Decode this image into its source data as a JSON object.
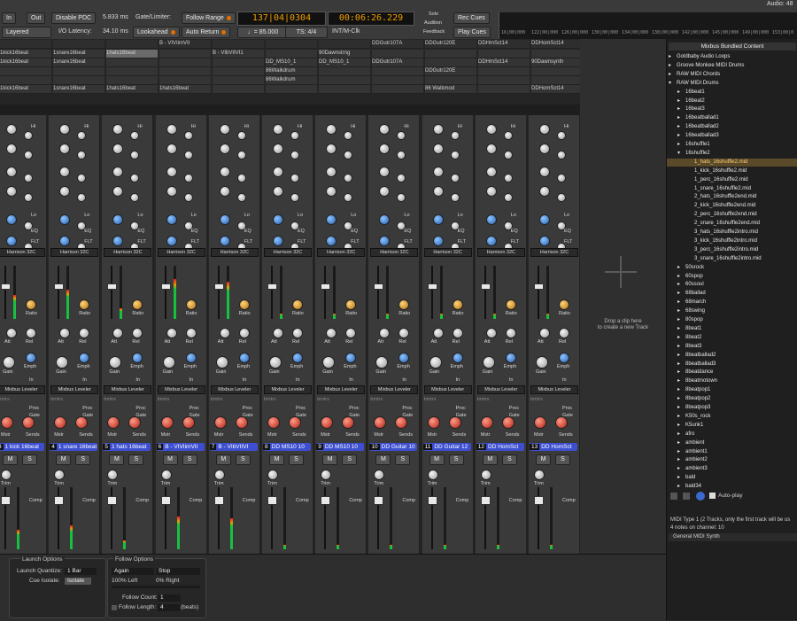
{
  "toolbar": {
    "in_label": "In",
    "out_label": "Out",
    "layered_label": "Layered",
    "disable_pdc_label": "Disable PDC",
    "pdc_value": "5.833 ms",
    "io_latency_label": "I/O Latency:",
    "io_latency_value": "34.10 ms",
    "gate_limiter_label": "Gate/Limiter:",
    "lookahead_label": "Lookahead",
    "follow_range_label": "Follow Range",
    "auto_return_label": "Auto Return",
    "bbt_clock": "137|04|0304",
    "time_clock": "00:06:26.229",
    "tempo": "♩= 85.000",
    "time_sig": "TS: 4/4",
    "sync_label": "INT/M-Clk",
    "solo_label": "Solo",
    "audition_label": "Audition",
    "feedback_label": "Feedback",
    "rec_cues_label": "Rec Cues",
    "play_cues_label": "Play Cues",
    "audio_status": "Audio: 48",
    "ruler_ticks": [
      "16|00|000",
      "122|00|000",
      "126|00|000",
      "130|00|000",
      "134|00|000",
      "138|00|000",
      "142|00|000",
      "145|00|000",
      "149|00|000",
      "153|00|0"
    ]
  },
  "cues": {
    "columns": [
      {
        "header": "",
        "cells": [
          "1kick16beat",
          "1kick16beat",
          "",
          "",
          "1kick16beat"
        ]
      },
      {
        "header": "",
        "cells": [
          "1snare16beat",
          "1snare16beat",
          "",
          "",
          "1snare16beat"
        ]
      },
      {
        "header": "",
        "cells": [
          "1hats16beat",
          "",
          "",
          "",
          "1hats16beat"
        ]
      },
      {
        "header": "B - VIVIimVII",
        "cells": [
          "",
          "",
          "",
          "",
          "1hats16beat"
        ]
      },
      {
        "header": "",
        "cells": [
          "B - VIbVIIVI1",
          "",
          "",
          "",
          ""
        ]
      },
      {
        "header": "",
        "cells": [
          "",
          "DD_MS10_1",
          "86Walkdrum",
          "86Walkdrum",
          ""
        ]
      },
      {
        "header": "",
        "cells": [
          "90Dawnstrng",
          "DD_MS10_1",
          "",
          "",
          ""
        ]
      },
      {
        "header": "DDGutr107A",
        "cells": [
          "",
          "DDGutr107A",
          "",
          "",
          ""
        ]
      },
      {
        "header": "DDGutr120E",
        "cells": [
          "",
          "",
          "DDGutr120E",
          "",
          "86 Walkmod"
        ]
      },
      {
        "header": "DDHmSct14",
        "cells": [
          "",
          "DDHmSct14",
          "",
          "",
          ""
        ]
      },
      {
        "header": "DDHomSct14",
        "cells": [
          "",
          "90Dawnsynth",
          "",
          "",
          "DDHomSct14"
        ]
      }
    ]
  },
  "strips": [
    {
      "num": "3",
      "name": "1 kick 16beat",
      "eq_plugin": "Harrison 32C",
      "dyn_plugin": "Mixbus Leveler",
      "meter": 0.45
    },
    {
      "num": "4",
      "name": "1 snare 16beat",
      "eq_plugin": "Harrison 32C",
      "dyn_plugin": "Mixbus Leveler",
      "meter": 0.55
    },
    {
      "num": "5",
      "name": "1 hats 16beat",
      "eq_plugin": "Harrison 32C",
      "dyn_plugin": "Mixbus Leveler",
      "meter": 0.2
    },
    {
      "num": "6",
      "name": "B - VIVIimVII",
      "eq_plugin": "Harrison 32C",
      "dyn_plugin": "Mixbus Leveler",
      "meter": 0.75
    },
    {
      "num": "7",
      "name": "B - VIbVIIVI",
      "eq_plugin": "Harrison 32C",
      "dyn_plugin": "Mixbus Leveler",
      "meter": 0.7
    },
    {
      "num": "8",
      "name": "DD MS10 10",
      "eq_plugin": "Harrison 32C",
      "dyn_plugin": "Mixbus Leveler",
      "meter": 0.1
    },
    {
      "num": "9",
      "name": "DD MS10 10",
      "eq_plugin": "Harrison 32C",
      "dyn_plugin": "Mixbus Leveler",
      "meter": 0.1
    },
    {
      "num": "10",
      "name": "DD Guitar 10",
      "eq_plugin": "Harrison 32C",
      "dyn_plugin": "Mixbus Leveler",
      "meter": 0.1
    },
    {
      "num": "11",
      "name": "DD Guitar 12",
      "eq_plugin": "Harrison 32C",
      "dyn_plugin": "Mixbus Leveler",
      "meter": 0.1
    },
    {
      "num": "12",
      "name": "DD HomSct",
      "eq_plugin": "Harrison 32C",
      "dyn_plugin": "Mixbus Leveler",
      "meter": 0.1
    },
    {
      "num": "13",
      "name": "DD HomSct",
      "eq_plugin": "Harrison 32C",
      "dyn_plugin": "Mixbus Leveler",
      "meter": 0.1
    }
  ],
  "strip_labels": {
    "hi": "Hi",
    "lo": "Lo",
    "eq": "EQ",
    "flt": "FLT",
    "ratio": "Ratio",
    "att": "Att",
    "rel": "Rel",
    "emph": "Emph",
    "gain": "Gain",
    "in": "In",
    "sends": "Sends",
    "mstr": "Mstr",
    "trim": "Trim",
    "m": "M",
    "s": "S",
    "comp": "Comp",
    "gate": "Gate",
    "proc": "Proc",
    "bmtrs": "bmtrs"
  },
  "drop": {
    "line1": "Drop a clip here",
    "line2": "to create a new Track"
  },
  "sidebar": {
    "title": "Mixbus Bundled Content",
    "items": [
      {
        "label": "Goldbaby Audio Loops",
        "depth": 0,
        "arrow": "▸"
      },
      {
        "label": "Groove Monkee MIDI Drums",
        "depth": 0,
        "arrow": "▸"
      },
      {
        "label": "RAW MIDI Chords",
        "depth": 0,
        "arrow": "▸"
      },
      {
        "label": "RAW MIDI Drums",
        "depth": 0,
        "arrow": "▾"
      },
      {
        "label": "16beat1",
        "depth": 1,
        "arrow": "▸"
      },
      {
        "label": "16beat2",
        "depth": 1,
        "arrow": "▸"
      },
      {
        "label": "16beat3",
        "depth": 1,
        "arrow": "▸"
      },
      {
        "label": "16beatballad1",
        "depth": 1,
        "arrow": "▸"
      },
      {
        "label": "16beatballad2",
        "depth": 1,
        "arrow": "▸"
      },
      {
        "label": "16beatballad3",
        "depth": 1,
        "arrow": "▸"
      },
      {
        "label": "16shuffle1",
        "depth": 1,
        "arrow": "▸"
      },
      {
        "label": "16shuffle2",
        "depth": 1,
        "arrow": "▾"
      },
      {
        "label": "1_hats_16shuffle2.mid",
        "depth": 2,
        "arrow": "",
        "selected": true
      },
      {
        "label": "1_kick_16shuffle2.mid",
        "depth": 2,
        "arrow": ""
      },
      {
        "label": "1_perc_16shuffle2.mid",
        "depth": 2,
        "arrow": ""
      },
      {
        "label": "1_snare_16shuffle2.mid",
        "depth": 2,
        "arrow": ""
      },
      {
        "label": "2_hats_16shuffle2end.mid",
        "depth": 2,
        "arrow": ""
      },
      {
        "label": "2_kick_16shuffle2end.mid",
        "depth": 2,
        "arrow": ""
      },
      {
        "label": "2_perc_16shuffle2end.mid",
        "depth": 2,
        "arrow": ""
      },
      {
        "label": "2_snare_16shuffle2end.mid",
        "depth": 2,
        "arrow": ""
      },
      {
        "label": "3_hats_16shuffle2intro.mid",
        "depth": 2,
        "arrow": ""
      },
      {
        "label": "3_kick_16shuffle2intro.mid",
        "depth": 2,
        "arrow": ""
      },
      {
        "label": "3_perc_16shuffle2intro.mid",
        "depth": 2,
        "arrow": ""
      },
      {
        "label": "3_snare_16shuffle2intro.mid",
        "depth": 2,
        "arrow": ""
      },
      {
        "label": "50srock",
        "depth": 1,
        "arrow": "▸"
      },
      {
        "label": "60spop",
        "depth": 1,
        "arrow": "▸"
      },
      {
        "label": "60ssoul",
        "depth": 1,
        "arrow": "▸"
      },
      {
        "label": "68ballad",
        "depth": 1,
        "arrow": "▸"
      },
      {
        "label": "68march",
        "depth": 1,
        "arrow": "▸"
      },
      {
        "label": "68swing",
        "depth": 1,
        "arrow": "▸"
      },
      {
        "label": "80spop",
        "depth": 1,
        "arrow": "▸"
      },
      {
        "label": "8beat1",
        "depth": 1,
        "arrow": "▸"
      },
      {
        "label": "8beat2",
        "depth": 1,
        "arrow": "▸"
      },
      {
        "label": "8beat3",
        "depth": 1,
        "arrow": "▸"
      },
      {
        "label": "8beatballad2",
        "depth": 1,
        "arrow": "▸"
      },
      {
        "label": "8beatballad3",
        "depth": 1,
        "arrow": "▸"
      },
      {
        "label": "8beatdance",
        "depth": 1,
        "arrow": "▸"
      },
      {
        "label": "8beatmotown",
        "depth": 1,
        "arrow": "▸"
      },
      {
        "label": "8beatpop1",
        "depth": 1,
        "arrow": "▸"
      },
      {
        "label": "8beatpop2",
        "depth": 1,
        "arrow": "▸"
      },
      {
        "label": "8beatpop3",
        "depth": 1,
        "arrow": "▸"
      },
      {
        "label": "K50s_rock",
        "depth": 1,
        "arrow": "▸"
      },
      {
        "label": "K5unk1",
        "depth": 1,
        "arrow": "▸"
      },
      {
        "label": "afro",
        "depth": 1,
        "arrow": "▸"
      },
      {
        "label": "ambient",
        "depth": 1,
        "arrow": "▸"
      },
      {
        "label": "ambient1",
        "depth": 1,
        "arrow": "▸"
      },
      {
        "label": "ambient2",
        "depth": 1,
        "arrow": "▸"
      },
      {
        "label": "ambient3",
        "depth": 1,
        "arrow": "▸"
      },
      {
        "label": "bald",
        "depth": 1,
        "arrow": "▸"
      },
      {
        "label": "bald34",
        "depth": 1,
        "arrow": "▸"
      }
    ],
    "autoplay_label": "Auto-play",
    "info_line1": "MIDI Type 1 (2 Tracks, only the first track will be us",
    "info_line2": "4 notes on channel: 10",
    "synth_label": "General MIDI Synth"
  },
  "launch": {
    "title": "Launch Options",
    "quantize_label": "Launch Quantize:",
    "quantize_value": "1 Bar",
    "cue_isolate_label": "Cue Isolate:",
    "cue_isolate_value": "Isolate"
  },
  "follow": {
    "title": "Follow Options",
    "again_value": "Again",
    "stop_value": "Stop",
    "left_value": "100% Left",
    "right_value": "0% Right",
    "count_label": "Follow Count:",
    "count_value": "1",
    "length_label": "Follow Length:",
    "length_value": "4",
    "beats_label": "(beats)"
  }
}
